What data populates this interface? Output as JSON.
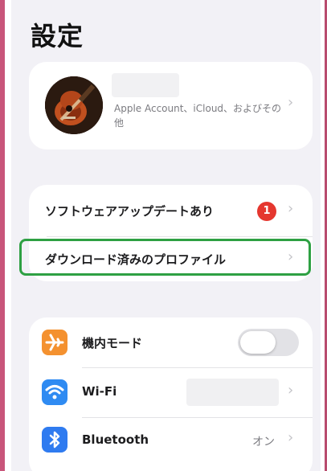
{
  "page": {
    "title": "設定"
  },
  "account": {
    "subtitle": "Apple Account、iCloud、およびその他"
  },
  "rows": {
    "software_update": {
      "label": "ソフトウェアアップデートあり",
      "badge": "1"
    },
    "downloaded_profile": {
      "label": "ダウンロード済みのプロファイル"
    }
  },
  "network": {
    "airplane": {
      "label": "機内モード",
      "icon": "airplane-icon",
      "toggle_on": false,
      "color": "#f4912f"
    },
    "wifi": {
      "label": "Wi-Fi",
      "icon": "wifi-icon",
      "color": "#2f8bf2"
    },
    "bluetooth": {
      "label": "Bluetooth",
      "value": "オン",
      "icon": "bluetooth-icon",
      "color": "#2f7bf0"
    }
  },
  "chevron": "›",
  "colors": {
    "badge": "#e5372f",
    "highlight": "#2ea043",
    "background": "#f2f1f6"
  }
}
